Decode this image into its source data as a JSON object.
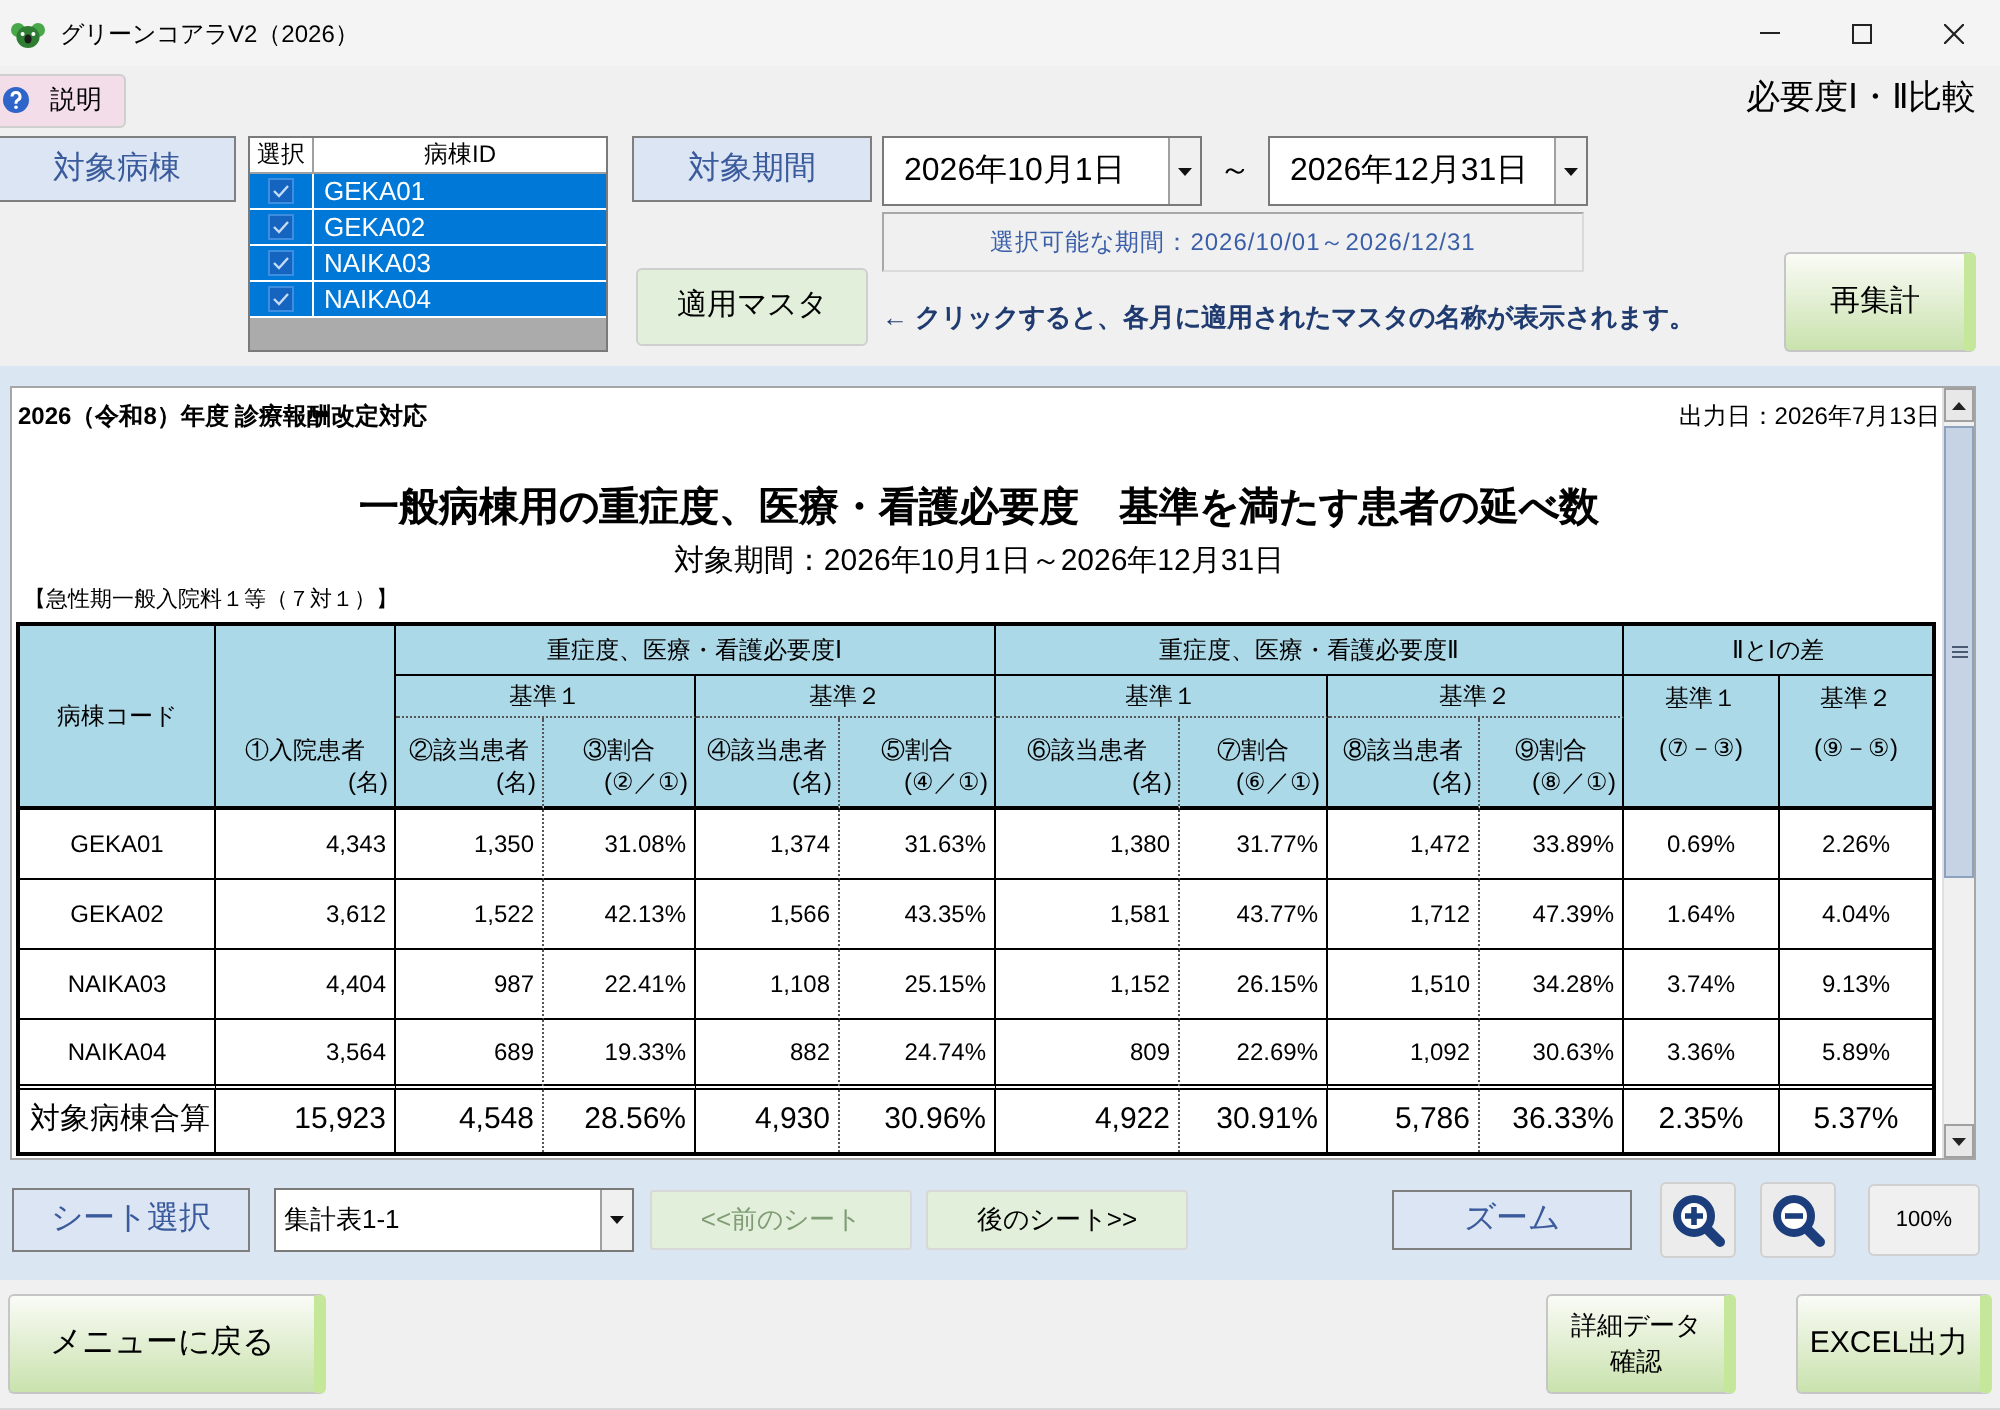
{
  "window": {
    "title": "グリーンコアラV2（2026）"
  },
  "help_button": "説明",
  "screen_title": "必要度Ⅰ・Ⅱ比較",
  "wards": {
    "label": "対象病棟",
    "columns": [
      "選択",
      "病棟ID"
    ],
    "items": [
      {
        "id": "GEKA01",
        "checked": true,
        "selected": true
      },
      {
        "id": "GEKA02",
        "checked": true,
        "selected": true
      },
      {
        "id": "NAIKA03",
        "checked": true,
        "selected": true
      },
      {
        "id": "NAIKA04",
        "checked": true,
        "selected": true
      }
    ]
  },
  "period": {
    "label": "対象期間",
    "start": "2026年10月1日",
    "separator": "～",
    "end": "2026年12月31日",
    "available": "選択可能な期間：2026/10/01～2026/12/31"
  },
  "master": {
    "button": "適用マスタ",
    "hint": "← クリックすると、各月に適用されたマスタの名称が表示されます。"
  },
  "recalc_button": "再集計",
  "report": {
    "edition": "2026（令和8）年度 診療報酬改定対応",
    "output_date": "出力日：2026年7月13日",
    "title": "一般病棟用の重症度、医療・看護必要度　基準を満たす患者の延べ数",
    "period": "対象期間：2026年10月1日～2026年12月31日",
    "category": "【急性期一般入院料１等（７対１）】",
    "table": {
      "ward_header": "病棟コード",
      "admitted_header": {
        "label": "①入院患者",
        "unit": "(名)"
      },
      "groups": [
        {
          "title": "重症度、医療・看護必要度Ⅰ",
          "criteria": [
            {
              "title": "基準１",
              "columns": [
                {
                  "label": "②該当患者",
                  "unit": "(名)"
                },
                {
                  "label": "③割合",
                  "unit": "(②／①)"
                }
              ]
            },
            {
              "title": "基準２",
              "columns": [
                {
                  "label": "④該当患者",
                  "unit": "(名)"
                },
                {
                  "label": "⑤割合",
                  "unit": "(④／①)"
                }
              ]
            }
          ]
        },
        {
          "title": "重症度、医療・看護必要度Ⅱ",
          "criteria": [
            {
              "title": "基準１",
              "columns": [
                {
                  "label": "⑥該当患者",
                  "unit": "(名)"
                },
                {
                  "label": "⑦割合",
                  "unit": "(⑥／①)"
                }
              ]
            },
            {
              "title": "基準２",
              "columns": [
                {
                  "label": "⑧該当患者",
                  "unit": "(名)"
                },
                {
                  "label": "⑨割合",
                  "unit": "(⑧／①)"
                }
              ]
            }
          ]
        }
      ],
      "difference": {
        "title": "ⅡとⅠの差",
        "columns": [
          {
            "label": "基準１",
            "formula": "(⑦－③)"
          },
          {
            "label": "基準２",
            "formula": "(⑨－⑤)"
          }
        ]
      },
      "rows": [
        {
          "ward": "GEKA01",
          "values": [
            "4,343",
            "1,350",
            "31.08%",
            "1,374",
            "31.63%",
            "1,380",
            "31.77%",
            "1,472",
            "33.89%",
            "0.69%",
            "2.26%"
          ]
        },
        {
          "ward": "GEKA02",
          "values": [
            "3,612",
            "1,522",
            "42.13%",
            "1,566",
            "43.35%",
            "1,581",
            "43.77%",
            "1,712",
            "47.39%",
            "1.64%",
            "4.04%"
          ]
        },
        {
          "ward": "NAIKA03",
          "values": [
            "4,404",
            "987",
            "22.41%",
            "1,108",
            "25.15%",
            "1,152",
            "26.15%",
            "1,510",
            "34.28%",
            "3.74%",
            "9.13%"
          ]
        },
        {
          "ward": "NAIKA04",
          "values": [
            "3,564",
            "689",
            "19.33%",
            "882",
            "24.74%",
            "809",
            "22.69%",
            "1,092",
            "30.63%",
            "3.36%",
            "5.89%"
          ]
        }
      ],
      "total": {
        "label": "対象病棟合算",
        "values": [
          "15,923",
          "4,548",
          "28.56%",
          "4,930",
          "30.96%",
          "4,922",
          "30.91%",
          "5,786",
          "36.33%",
          "2.35%",
          "5.37%"
        ]
      }
    }
  },
  "sheet_bar": {
    "label": "シート選択",
    "sheet": "集計表1-1",
    "nav": [
      {
        "label": "<<前のシート",
        "disabled": true
      },
      {
        "label": "後のシート>>",
        "disabled": false
      }
    ],
    "zoom_label": "ズーム",
    "zoom_level": "100%"
  },
  "footer": {
    "back": "メニューに戻る",
    "detail": [
      "詳細データ",
      "確認"
    ],
    "export": "EXCEL出力"
  }
}
